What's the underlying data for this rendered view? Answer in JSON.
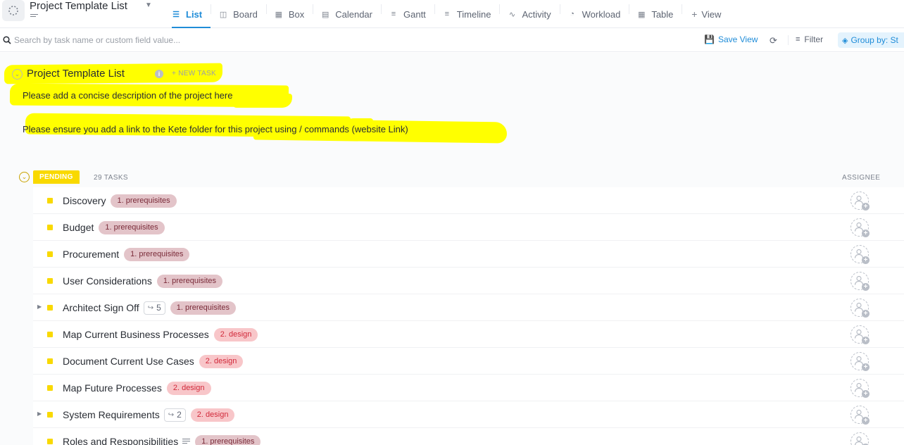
{
  "header": {
    "title": "Project Template List",
    "views": [
      {
        "label": "List",
        "icon": "list-icon",
        "active": true
      },
      {
        "label": "Board",
        "icon": "board-icon"
      },
      {
        "label": "Box",
        "icon": "box-icon"
      },
      {
        "label": "Calendar",
        "icon": "calendar-icon"
      },
      {
        "label": "Gantt",
        "icon": "gantt-icon"
      },
      {
        "label": "Timeline",
        "icon": "timeline-icon"
      },
      {
        "label": "Activity",
        "icon": "activity-icon"
      },
      {
        "label": "Workload",
        "icon": "workload-icon"
      },
      {
        "label": "Table",
        "icon": "table-icon"
      }
    ],
    "add_view_label": "View"
  },
  "toolbar": {
    "search_placeholder": "Search by task name or custom field value...",
    "save_view_label": "Save View",
    "filter_label": "Filter",
    "group_by_label": "Group by: St"
  },
  "list": {
    "heading": "Project Template List",
    "new_task_label": "+ NEW TASK",
    "description_line1": "Please add a concise description of the project here",
    "description_line2": "Please ensure you add a link to the Kete folder for this project using / commands (website Link)",
    "highlight_color": "#ffff00"
  },
  "group": {
    "status": "PENDING",
    "status_color": "#f9d900",
    "task_count": "29 TASKS",
    "assignee_header": "ASSIGNEE"
  },
  "tasks": [
    {
      "name": "Discovery",
      "tag": "1. prerequisites",
      "tag_type": "prereq"
    },
    {
      "name": "Budget",
      "tag": "1. prerequisites",
      "tag_type": "prereq"
    },
    {
      "name": "Procurement",
      "tag": "1. prerequisites",
      "tag_type": "prereq"
    },
    {
      "name": "User Considerations",
      "tag": "1. prerequisites",
      "tag_type": "prereq"
    },
    {
      "name": "Architect Sign Off",
      "tag": "1. prerequisites",
      "tag_type": "prereq",
      "subtasks": "5",
      "expandable": true
    },
    {
      "name": "Map Current Business Processes",
      "tag": "2. design",
      "tag_type": "design"
    },
    {
      "name": "Document Current Use Cases",
      "tag": "2. design",
      "tag_type": "design"
    },
    {
      "name": "Map Future Processes",
      "tag": "2. design",
      "tag_type": "design"
    },
    {
      "name": "System Requirements",
      "tag": "2. design",
      "tag_type": "design",
      "subtasks": "2",
      "expandable": true
    },
    {
      "name": "Roles and Responsibilities",
      "tag": "1. prerequisites",
      "tag_type": "prereq",
      "has_description": true
    }
  ]
}
